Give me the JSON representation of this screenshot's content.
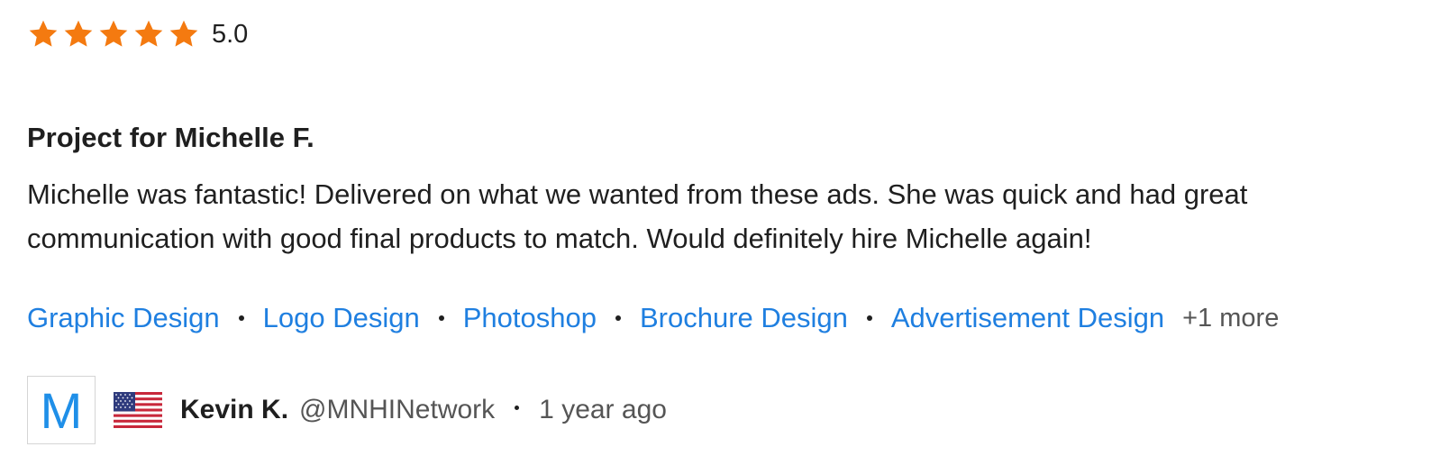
{
  "rating": {
    "stars": 5,
    "max_stars": 5,
    "value_label": "5.0",
    "star_color": "#f47a10"
  },
  "review": {
    "title": "Project for Michelle F.",
    "body_line1": "Michelle was fantastic! Delivered on what we wanted from these ads. She was quick and had great",
    "body_line2": "communication with good final products to match. Would definitely hire Michelle again!"
  },
  "skills": {
    "items": [
      "Graphic Design",
      "Logo Design",
      "Photoshop",
      "Brochure Design",
      "Advertisement Design"
    ],
    "more_label": "+1 more",
    "link_color": "#1f7fe0"
  },
  "author": {
    "avatar_letter": "M",
    "flag_icon": "us-flag-icon",
    "name": "Kevin K.",
    "handle": "@MNHINetwork",
    "time_ago": "1 year ago"
  }
}
